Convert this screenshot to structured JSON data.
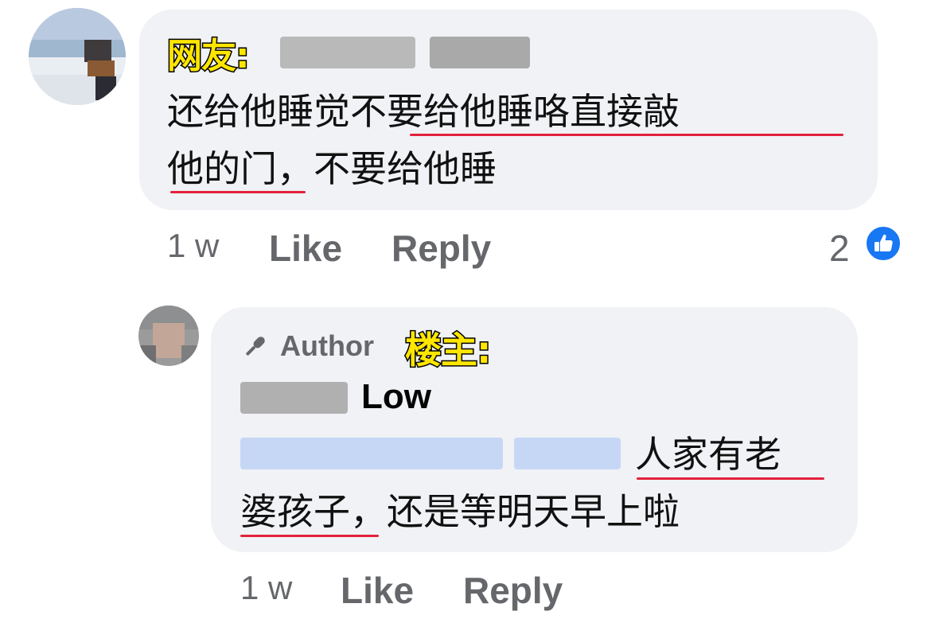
{
  "comment": {
    "tag": "网友:",
    "text_line1": "还给他睡觉不要给他睡咯直接敲",
    "text_line2": "他的门，不要给他睡",
    "time": "1 w",
    "like_label": "Like",
    "reply_label": "Reply",
    "reaction_count": "2",
    "reaction_icon": "thumbs-up-icon",
    "colors": {
      "bubble": "#f0f2f5",
      "underline": "#e3213c",
      "like_blue": "#1877f2"
    }
  },
  "reply": {
    "author_badge": "Author",
    "tag": "楼主:",
    "name_suffix": "Low",
    "text_line1": "人家有老",
    "text_line2": "婆孩子，还是等明天早上啦",
    "time": "1 w",
    "like_label": "Like",
    "reply_label": "Reply"
  }
}
